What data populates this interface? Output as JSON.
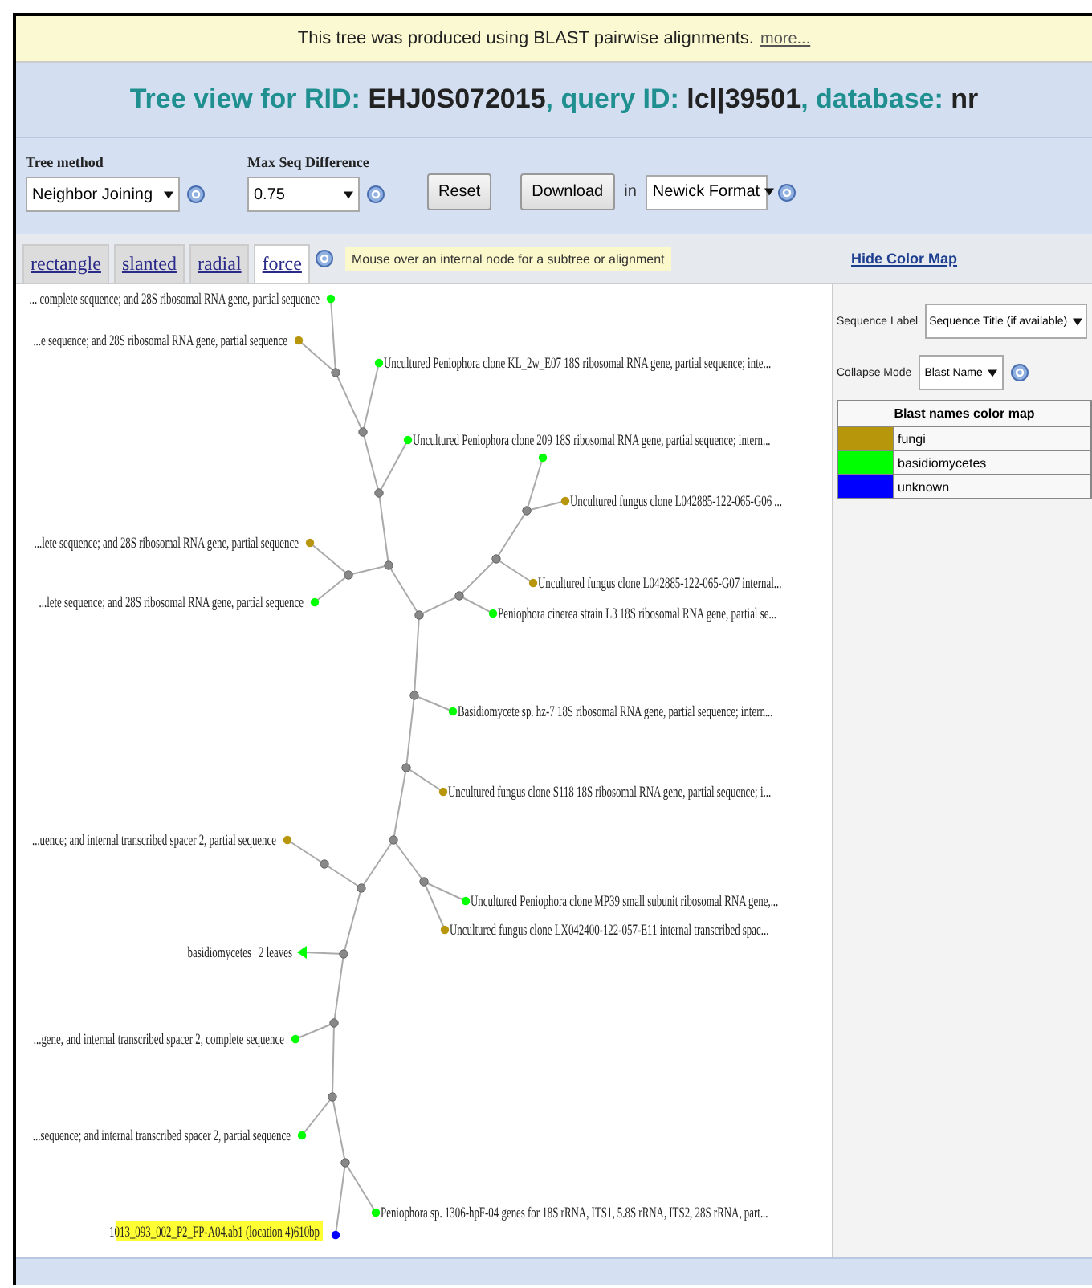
{
  "banner": {
    "text": "This tree was produced using BLAST pairwise alignments.",
    "link": "more..."
  },
  "title": [
    {
      "kind": "label",
      "text": "Tree view for RID:"
    },
    {
      "kind": "value",
      "text": "EHJ0S072015"
    },
    {
      "kind": "label",
      "text": ", query ID:"
    },
    {
      "kind": "value",
      "text": "lcl|39501"
    },
    {
      "kind": "label",
      "text": ", database:"
    },
    {
      "kind": "value",
      "text": "nr"
    }
  ],
  "controls": {
    "tree_method": {
      "label": "Tree method",
      "value": "Neighbor Joining"
    },
    "max_seq_difference": {
      "label": "Max Seq Difference",
      "value": "0.75"
    },
    "reset_button": "Reset",
    "download_button": "Download",
    "in_text": "in",
    "format": {
      "value": "Newick Format"
    }
  },
  "tabs": [
    {
      "label": "rectangle",
      "selected": false
    },
    {
      "label": "slanted",
      "selected": false
    },
    {
      "label": "radial",
      "selected": false
    },
    {
      "label": "force",
      "selected": true
    }
  ],
  "hint": "Mouse over an internal node for a subtree or alignment",
  "side_panel": {
    "hide_link": "Hide Color Map",
    "sequence_label": {
      "label": "Sequence Label",
      "value": "Sequence Title (if available)"
    },
    "collapse_mode": {
      "label": "Collapse Mode",
      "value": "Blast Name"
    },
    "color_map": {
      "title": "Blast names color map",
      "entries": [
        {
          "name": "fungi",
          "color": "#b8960c"
        },
        {
          "name": "basidiomycetes",
          "color": "#00ff00"
        },
        {
          "name": "unknown",
          "color": "#0000ff"
        }
      ]
    }
  },
  "tree": {
    "leaves": [
      {
        "kind": "leaf",
        "label": "... complete sequence; and 28S ribosomal RNA gene, partial sequence",
        "color": "#00ff00",
        "selected": false
      },
      {
        "kind": "leaf",
        "label": "...e sequence; and 28S ribosomal RNA gene, partial sequence",
        "color": "#b8960c",
        "selected": false
      },
      {
        "kind": "leaf",
        "label": "Uncultured Peniophora clone KL_2w_E07 18S ribosomal RNA gene, partial sequence; inte...",
        "color": "#00ff00",
        "selected": false
      },
      {
        "kind": "leaf",
        "label": "Uncultured Peniophora clone 209 18S ribosomal RNA gene, partial sequence; intern...",
        "color": "#00ff00",
        "selected": false
      },
      {
        "kind": "leaf",
        "color": "#00ff00",
        "selected": false
      },
      {
        "kind": "leaf",
        "label": "Uncultured fungus clone L042885-122-065-G06 ...",
        "color": "#b8960c",
        "selected": false
      },
      {
        "kind": "leaf",
        "label": "...lete sequence; and 28S ribosomal RNA gene, partial sequence",
        "color": "#b8960c",
        "selected": false
      },
      {
        "kind": "leaf",
        "label": "Uncultured fungus clone L042885-122-065-G07 internal...",
        "color": "#b8960c",
        "selected": false
      },
      {
        "kind": "leaf",
        "label": "...lete sequence; and 28S ribosomal RNA gene, partial sequence",
        "color": "#00ff00",
        "selected": false
      },
      {
        "kind": "leaf",
        "label": "Peniophora cinerea strain L3 18S ribosomal RNA gene, partial se...",
        "color": "#00ff00",
        "selected": false
      },
      {
        "kind": "leaf",
        "label": "Basidiomycete sp. hz-7 18S ribosomal RNA gene, partial sequence; intern...",
        "color": "#00ff00",
        "selected": false
      },
      {
        "kind": "leaf",
        "label": "Uncultured fungus clone S118 18S ribosomal RNA gene, partial sequence; i...",
        "color": "#b8960c",
        "selected": false
      },
      {
        "kind": "leaf",
        "label": "...uence; and internal transcribed spacer 2, partial sequence",
        "color": "#b8960c",
        "selected": false
      },
      {
        "kind": "leaf",
        "label": "Uncultured Peniophora clone MP39 small subunit ribosomal RNA gene,...",
        "color": "#00ff00",
        "selected": false
      },
      {
        "kind": "leaf",
        "label": "Uncultured fungus clone LX042400-122-057-E11 internal transcribed spac...",
        "color": "#b8960c",
        "selected": false
      },
      {
        "kind": "group",
        "label": "basidiomycetes | 2 leaves",
        "color": "#00ff00",
        "selected": false
      },
      {
        "kind": "leaf",
        "label": "...gene, and internal transcribed spacer 2, complete sequence",
        "color": "#00ff00",
        "selected": false
      },
      {
        "kind": "leaf",
        "label": "...sequence; and internal transcribed spacer 2, partial sequence",
        "color": "#00ff00",
        "selected": false
      },
      {
        "kind": "leaf",
        "label": "Peniophora sp. 1306-hpF-04 genes for 18S rRNA, ITS1, 5.8S rRNA, ITS2, 28S rRNA, part...",
        "color": "#00ff00",
        "selected": false
      },
      {
        "kind": "leaf",
        "label": "1013_093_002_P2_FP-A04.ab1 (location 4)610bp",
        "color": "#0000ff",
        "selected": true
      }
    ]
  }
}
